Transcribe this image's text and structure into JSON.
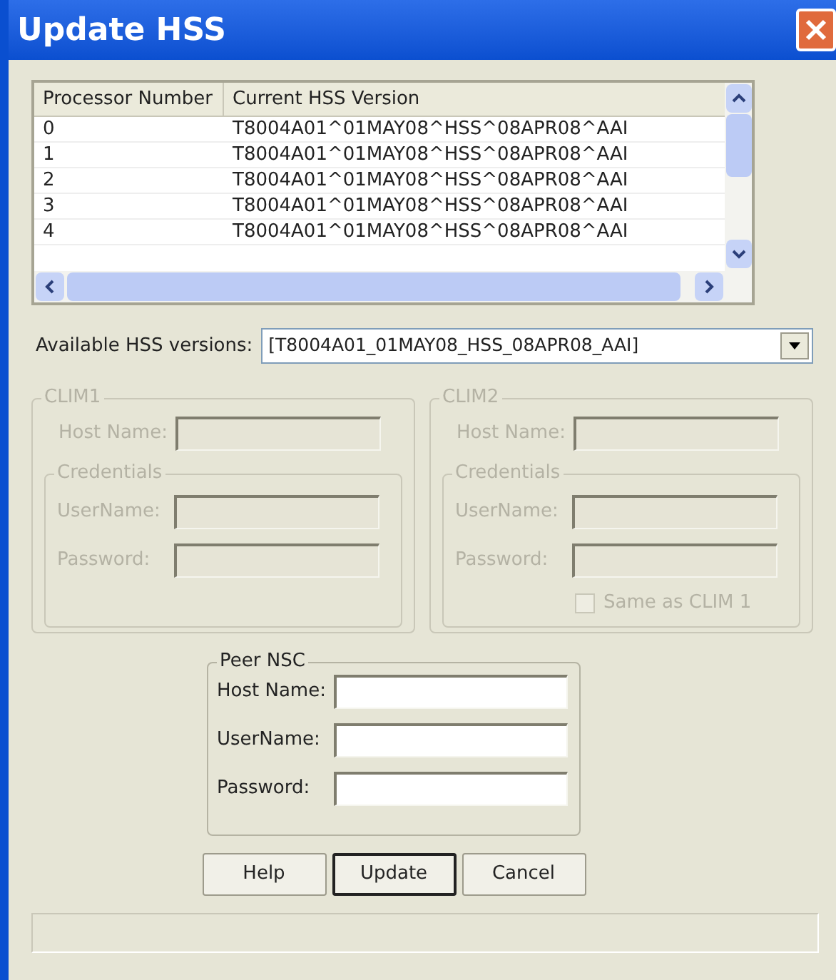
{
  "window": {
    "title": "Update HSS"
  },
  "table": {
    "columns": [
      "Processor Number",
      "Current HSS Version"
    ],
    "rows": [
      [
        "0",
        "T8004A01^01MAY08^HSS^08APR08^AAI"
      ],
      [
        "1",
        "T8004A01^01MAY08^HSS^08APR08^AAI"
      ],
      [
        "2",
        "T8004A01^01MAY08^HSS^08APR08^AAI"
      ],
      [
        "3",
        "T8004A01^01MAY08^HSS^08APR08^AAI"
      ],
      [
        "4",
        "T8004A01^01MAY08^HSS^08APR08^AAI"
      ]
    ]
  },
  "available_versions": {
    "label": "Available HSS versions:",
    "value": "[T8004A01_01MAY08_HSS_08APR08_AAI]"
  },
  "clim_groups": [
    {
      "title": "CLIM1",
      "disabled": true,
      "host_label": "Host Name:",
      "credentials_title": "Credentials",
      "user_label": "UserName:",
      "password_label": "Password:"
    },
    {
      "title": "CLIM2",
      "disabled": true,
      "host_label": "Host Name:",
      "credentials_title": "Credentials",
      "user_label": "UserName:",
      "password_label": "Password:",
      "same_as": {
        "label": "Same as CLIM 1",
        "checked": false
      }
    }
  ],
  "peer_nsc": {
    "title": "Peer NSC",
    "fields": [
      "Host Name:",
      "UserName:",
      "Password:"
    ]
  },
  "buttons": [
    {
      "label": "Help",
      "default": false
    },
    {
      "label": "Update",
      "default": true
    },
    {
      "label": "Cancel",
      "default": false
    }
  ]
}
